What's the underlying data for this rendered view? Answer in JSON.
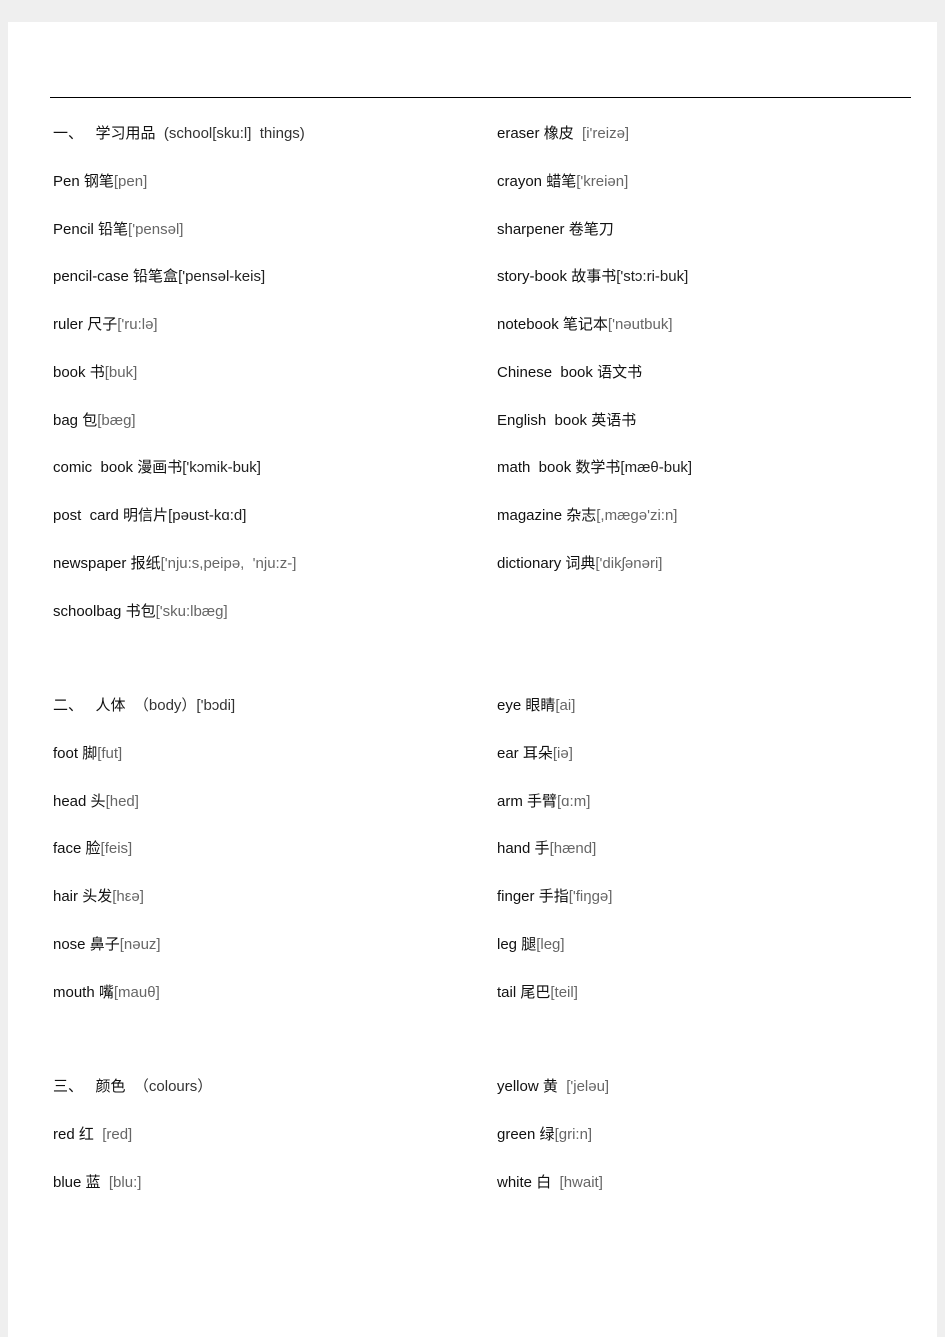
{
  "sections": [
    {
      "header": {
        "num": "一、",
        "zh": "学习用品",
        "en": "(school[sku:l]  things)"
      },
      "left": [
        {
          "en": "Pen ",
          "zh": "钢笔",
          "ph": "[pen]"
        },
        {
          "en": "Pencil ",
          "zh": "铅笔",
          "ph": "['pensəl]"
        },
        {
          "en": "pencil-case ",
          "zh": "铅笔盒",
          "ph": "['pensəl-keis]",
          "dark": true
        },
        {
          "en": "ruler ",
          "zh": "尺子",
          "ph": "['ru:lə]"
        },
        {
          "en": "book ",
          "zh": "书",
          "ph": "[buk]"
        },
        {
          "en": "bag ",
          "zh": "包",
          "ph": "[bæg]"
        },
        {
          "en": "comic  book ",
          "zh": "漫画书",
          "ph": "['kɔmik-buk]",
          "dark": true
        },
        {
          "en": "post  card ",
          "zh": "明信片",
          "ph": "[pəust-kɑ:d]",
          "dark": true
        },
        {
          "en": "newspaper ",
          "zh": "报纸",
          "ph": "['nju:s,peipə,  'nju:z-]"
        },
        {
          "en": "schoolbag ",
          "zh": "书包",
          "ph": "['sku:lbæg]"
        }
      ],
      "right": [
        {
          "en": "eraser ",
          "zh": "橡皮",
          "ph": "  [i'reizə]"
        },
        {
          "en": "crayon ",
          "zh": "蜡笔",
          "ph": "['kreiən]"
        },
        {
          "en": "sharpener ",
          "zh": "卷笔刀",
          "ph": ""
        },
        {
          "en": "story-book ",
          "zh": "故事书",
          "ph": "['stɔ:ri-buk]",
          "dark": true
        },
        {
          "en": "notebook ",
          "zh": "笔记本",
          "ph": "['nəutbuk]"
        },
        {
          "en": "Chinese  book ",
          "zh": "语文书",
          "ph": ""
        },
        {
          "en": "English  book ",
          "zh": "英语书",
          "ph": ""
        },
        {
          "en": "math  book ",
          "zh": "数学书",
          "ph": "[mæθ-buk]",
          "dark": true
        },
        {
          "en": "magazine ",
          "zh": "杂志",
          "ph": "[,mægə'zi:n]"
        },
        {
          "en": "dictionary ",
          "zh": "词典",
          "ph": "['dikʃənəri]"
        }
      ]
    },
    {
      "header": {
        "num": "二、",
        "zh": "人体",
        "en": "（body）['bɔdi]"
      },
      "left": [
        {
          "en": "foot ",
          "zh": "脚",
          "ph": "[fut]"
        },
        {
          "en": "head ",
          "zh": "头",
          "ph": "[hed]"
        },
        {
          "en": "face ",
          "zh": "脸",
          "ph": "[feis]"
        },
        {
          "en": "hair ",
          "zh": "头发",
          "ph": "[hεə]"
        },
        {
          "en": "nose ",
          "zh": "鼻子",
          "ph": "[nəuz]"
        },
        {
          "en": "mouth ",
          "zh": "嘴",
          "ph": "[mauθ]"
        }
      ],
      "right": [
        {
          "en": "eye ",
          "zh": "眼睛",
          "ph": "[ai]"
        },
        {
          "en": "ear ",
          "zh": "耳朵",
          "ph": "[iə]"
        },
        {
          "en": "arm ",
          "zh": "手臂",
          "ph": "[ɑ:m]"
        },
        {
          "en": "hand ",
          "zh": "手",
          "ph": "[hænd]"
        },
        {
          "en": "finger ",
          "zh": "手指",
          "ph": "['fiŋgə]"
        },
        {
          "en": "leg ",
          "zh": "腿",
          "ph": "[leg]"
        },
        {
          "en": "tail ",
          "zh": "尾巴",
          "ph": "[teil]"
        }
      ]
    },
    {
      "header": {
        "num": "三、",
        "zh": "颜色",
        "en": "（colours）"
      },
      "left": [
        {
          "en": "red ",
          "zh": "红",
          "ph": "  [red]"
        },
        {
          "en": "blue ",
          "zh": "蓝",
          "ph": "  [blu:]"
        }
      ],
      "right": [
        {
          "en": "yellow ",
          "zh": "黄",
          "ph": "  ['jeləu]"
        },
        {
          "en": "green ",
          "zh": "绿",
          "ph": "[gri:n]"
        },
        {
          "en": "white ",
          "zh": "白",
          "ph": "  [hwait]"
        }
      ]
    }
  ]
}
